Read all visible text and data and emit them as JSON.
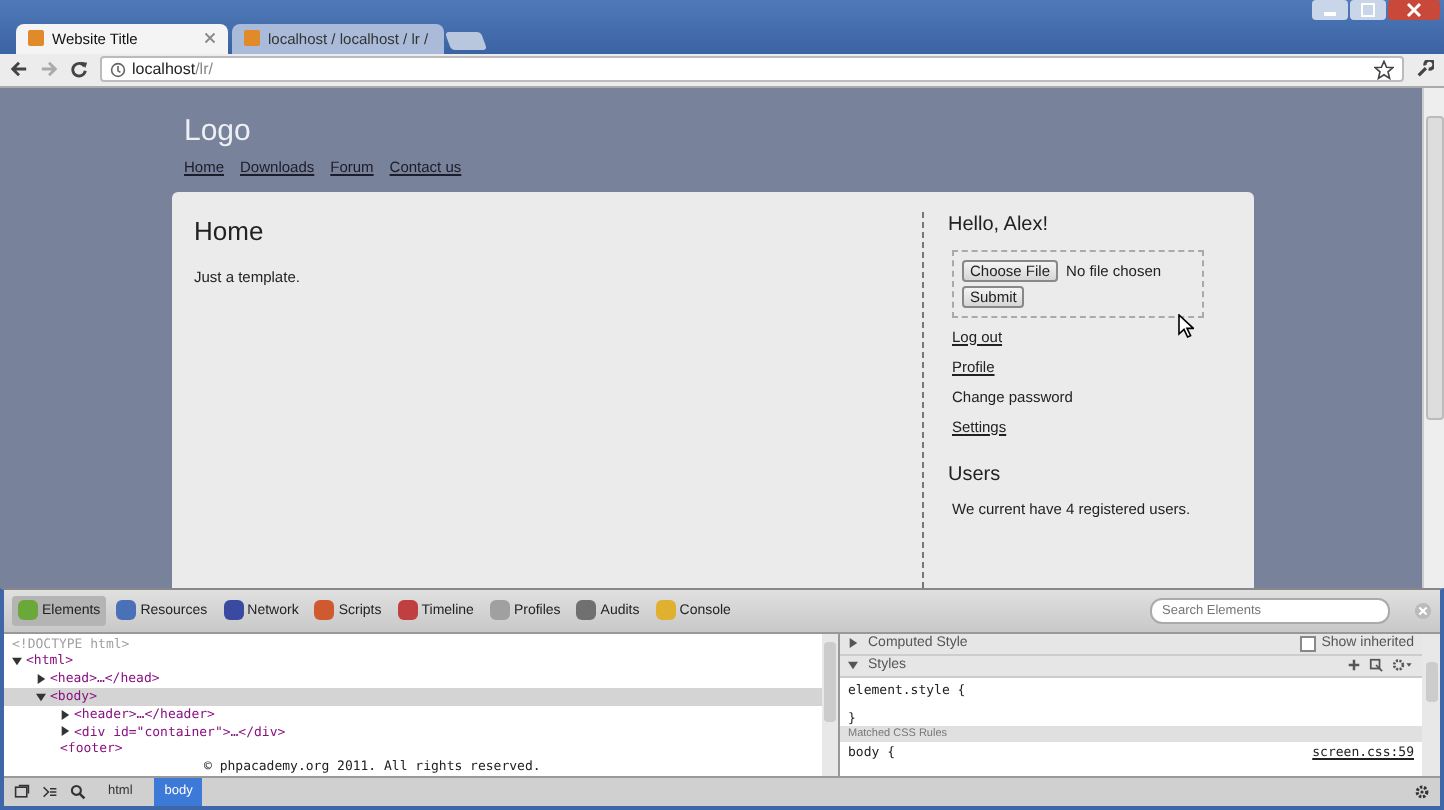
{
  "browser": {
    "tabs": [
      {
        "title": "Website Title",
        "selected": true
      },
      {
        "title": "localhost / localhost / lr /",
        "selected": false
      }
    ],
    "address": {
      "host": "localhost",
      "path": "/lr/"
    }
  },
  "page": {
    "logo": "Logo",
    "nav": [
      "Home",
      "Downloads",
      "Forum",
      "Contact us"
    ],
    "main": {
      "heading": "Home",
      "text": "Just a template."
    },
    "sidebar": {
      "greeting": "Hello, Alex!",
      "file_button": "Choose File",
      "file_status": "No file chosen",
      "submit": "Submit",
      "links": [
        {
          "label": "Log out",
          "underlined": true
        },
        {
          "label": "Profile",
          "underlined": true
        },
        {
          "label": "Change password",
          "underlined": false
        },
        {
          "label": "Settings",
          "underlined": true
        }
      ],
      "users_heading": "Users",
      "users_text": "We current have 4 registered users."
    }
  },
  "devtools": {
    "panels": [
      {
        "label": "Elements",
        "selected": true,
        "color": "#6aa83a"
      },
      {
        "label": "Resources",
        "selected": false,
        "color": "#4a70b8"
      },
      {
        "label": "Network",
        "selected": false,
        "color": "#3a4aa0"
      },
      {
        "label": "Scripts",
        "selected": false,
        "color": "#d05a30"
      },
      {
        "label": "Timeline",
        "selected": false,
        "color": "#c04040"
      },
      {
        "label": "Profiles",
        "selected": false,
        "color": "#a0a0a0"
      },
      {
        "label": "Audits",
        "selected": false,
        "color": "#707070"
      },
      {
        "label": "Console",
        "selected": false,
        "color": "#e0b030"
      }
    ],
    "search": {
      "placeholder": "Search Elements"
    },
    "dom_tree": [
      {
        "kind": "doctype",
        "text": "<!DOCTYPE html>",
        "selected": false
      },
      {
        "kind": "tag",
        "text": "<html>",
        "expanded": true,
        "selected": false,
        "children": [
          {
            "kind": "tag",
            "text": "<head>…</head>",
            "expanded": false,
            "selected": false
          },
          {
            "kind": "tag",
            "text": "<body>",
            "expanded": true,
            "selected": true,
            "children": [
              {
                "kind": "tag",
                "text": "<header>…</header>",
                "expanded": false,
                "selected": false
              },
              {
                "kind": "tag",
                "text": "<div id=\"container\">…</div>",
                "expanded": false,
                "selected": false
              },
              {
                "kind": "tag",
                "text": "<footer>",
                "selected": false,
                "children": [
                  {
                    "kind": "text",
                    "text": "© phpacademy.org 2011. All rights reserved.",
                    "selected": false
                  }
                ]
              }
            ]
          }
        ]
      }
    ],
    "sections": [
      {
        "title": "Computed Style",
        "expanded": false
      },
      {
        "title": "Styles",
        "expanded": true
      }
    ],
    "show_inherited": {
      "label": "Show inherited",
      "checked": false
    },
    "element_style": [
      "element.style {",
      "}"
    ],
    "matched_header": "Matched CSS Rules",
    "rule": {
      "selector": "body {",
      "source": "screen.css:59"
    },
    "breadcrumbs": [
      {
        "label": "html",
        "selected": false
      },
      {
        "label": "body",
        "selected": true
      }
    ]
  }
}
